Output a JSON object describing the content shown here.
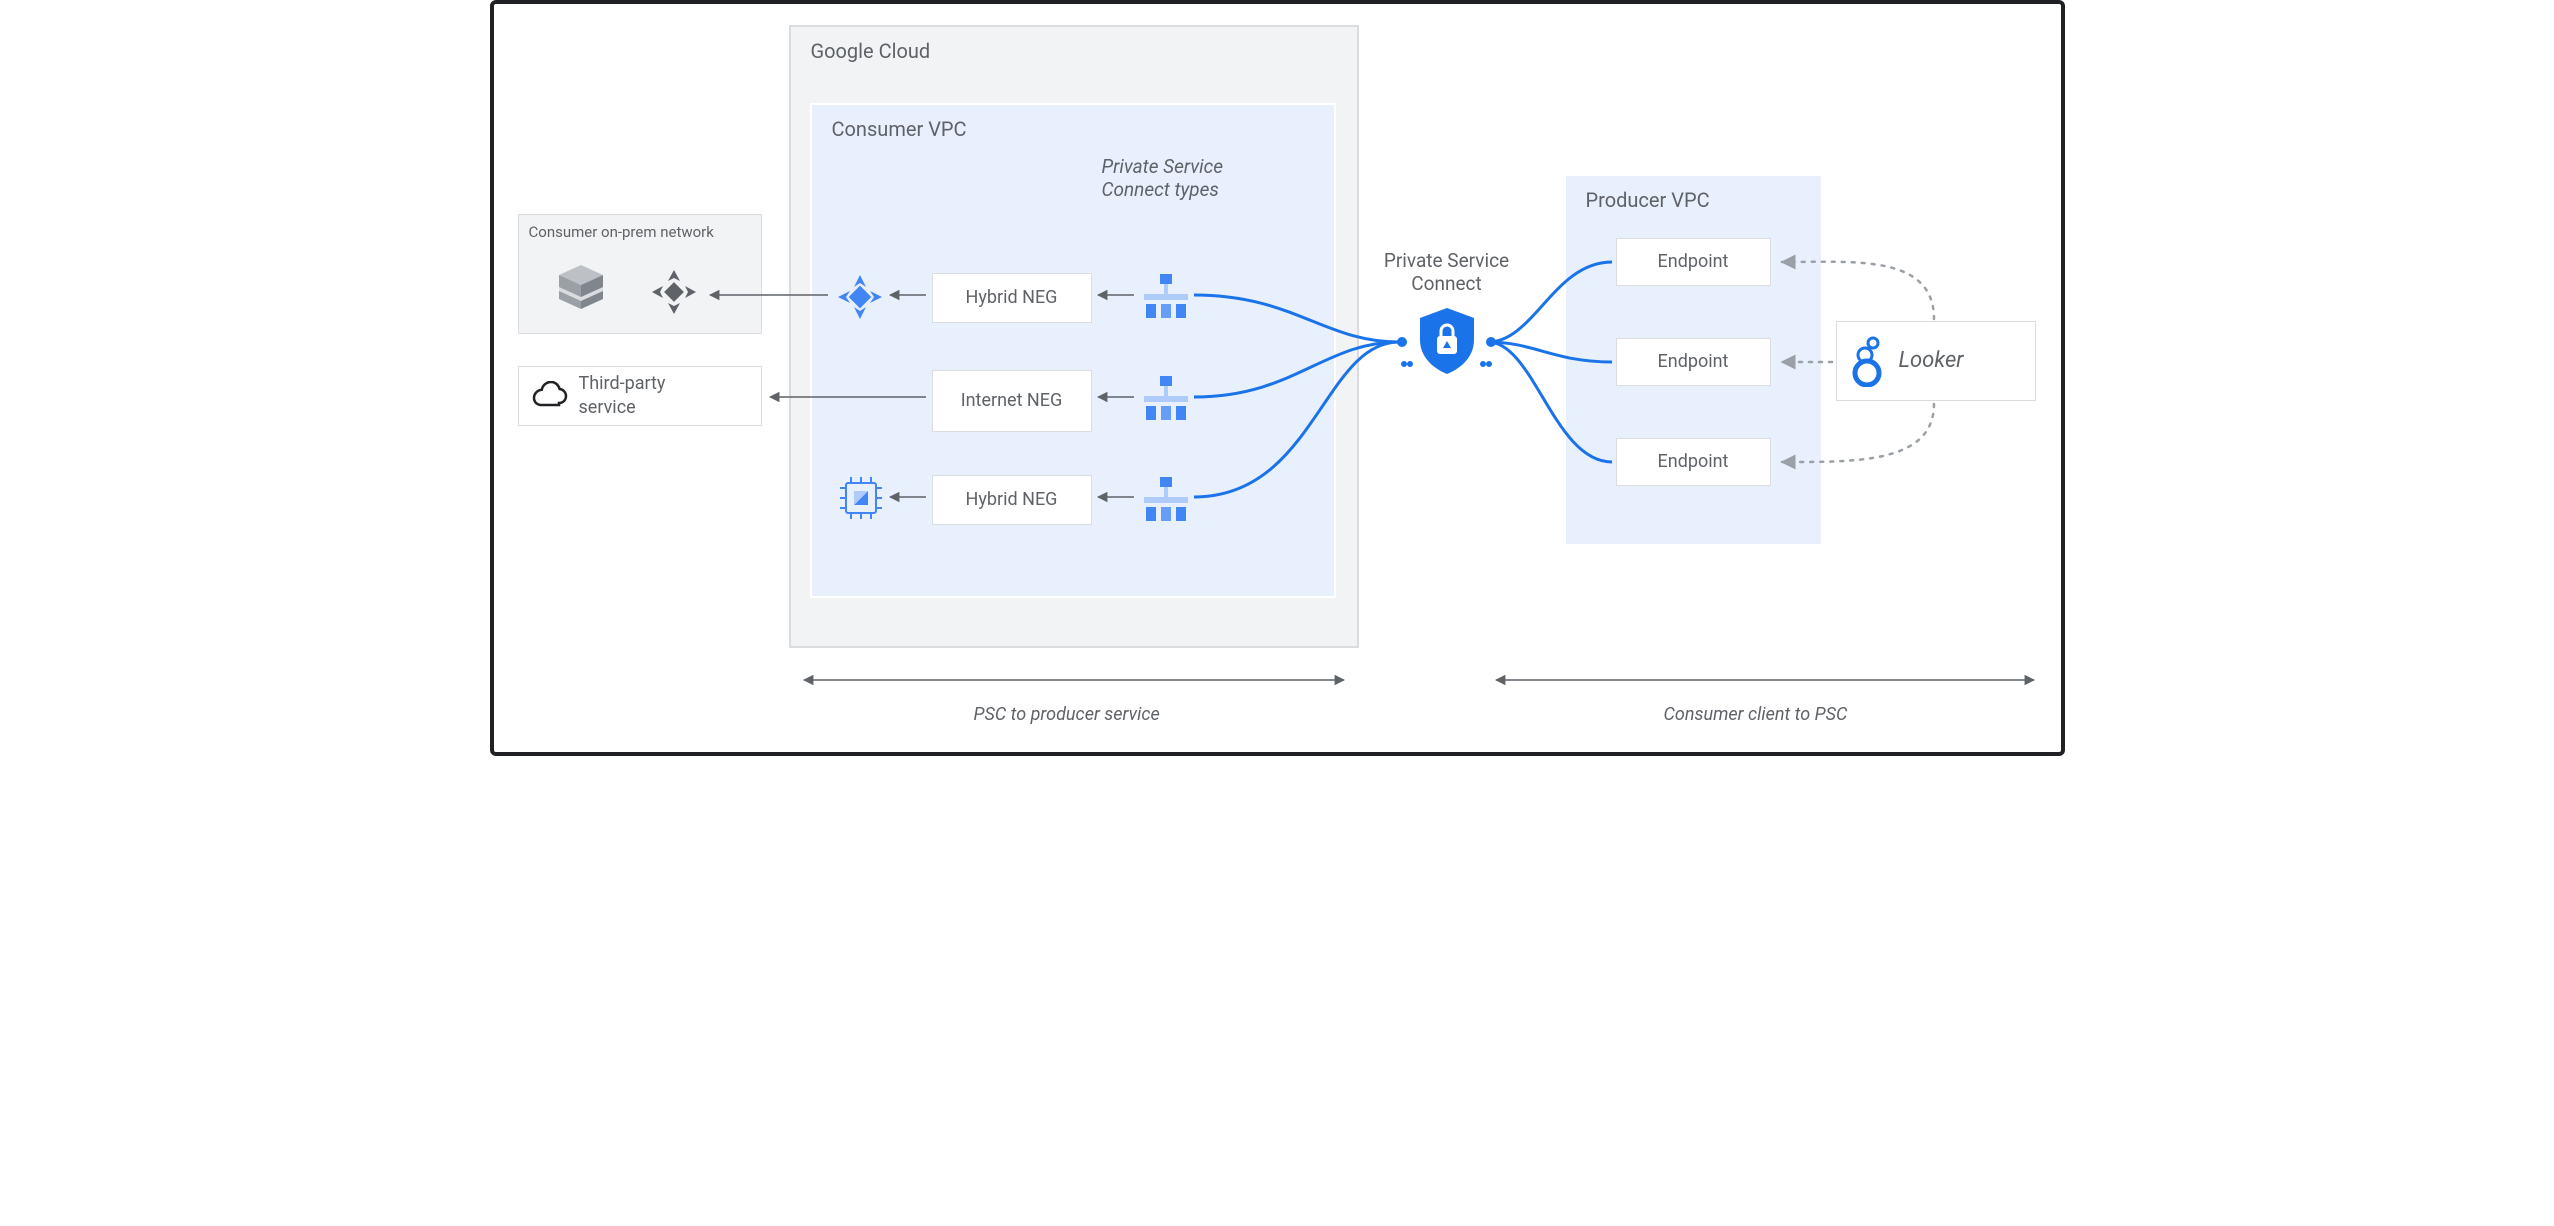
{
  "googleCloud": {
    "label": "Google Cloud"
  },
  "consumerVpc": {
    "label": "Consumer VPC",
    "subtitle": "Private Service\nConnect types",
    "negs": [
      "Hybrid NEG",
      "Internet NEG",
      "Hybrid NEG"
    ]
  },
  "producerVpc": {
    "label": "Producer VPC",
    "endpoints": [
      "Endpoint",
      "Endpoint",
      "Endpoint"
    ],
    "lookerLabel": "Looker"
  },
  "psc": {
    "label": "Private Service\nConnect"
  },
  "onPrem": {
    "label": "Consumer on-prem network"
  },
  "thirdParty": {
    "label": "Third-party\nservice"
  },
  "captions": {
    "left": "PSC to producer service",
    "right": "Consumer client to PSC"
  }
}
